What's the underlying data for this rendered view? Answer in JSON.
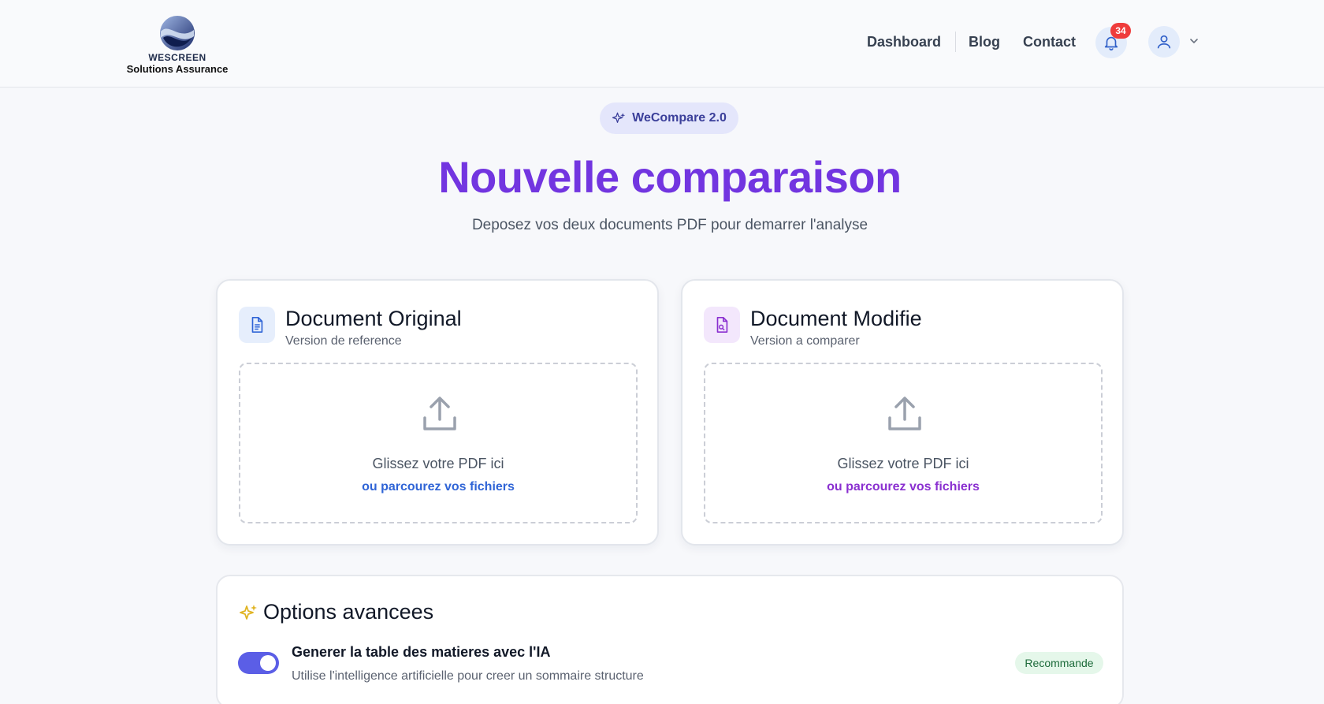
{
  "brand": {
    "name": "WESCREEN",
    "tagline": "Solutions Assurance"
  },
  "nav": {
    "links": [
      "Dashboard",
      "Blog",
      "Contact"
    ],
    "notifications_count": "34",
    "bell_icon": "bell-icon",
    "user_icon": "user-icon",
    "chevron_icon": "chevron-down-icon"
  },
  "hero": {
    "pill_label": "WeCompare 2.0",
    "title": "Nouvelle comparaison",
    "subtitle": "Deposez vos deux documents PDF pour demarrer l'analyse"
  },
  "cards": [
    {
      "title": "Document Original",
      "subtitle": "Version de reference",
      "drop_text": "Glissez votre PDF ici",
      "browse_text": "ou parcourez vos fichiers",
      "accent": "#2f64d6",
      "icon_bg": "#e6eefc"
    },
    {
      "title": "Document Modifie",
      "subtitle": "Version a comparer",
      "drop_text": "Glissez votre PDF ici",
      "browse_text": "ou parcourez vos fichiers",
      "accent": "#8a2fd0",
      "icon_bg": "#f3e7fc"
    }
  ],
  "options": {
    "title": "Options avancees",
    "toggle_label": "Generer la table des matieres avec l'IA",
    "toggle_desc": "Utilise l'intelligence artificielle pour creer un sommaire structure",
    "toggle_on": true,
    "badge": "Recommande"
  },
  "colors": {
    "title": "#7235e0",
    "toggle": "#5b5ee6",
    "badge_bg": "#e5f7ea",
    "notification": "#ef3c3c"
  }
}
